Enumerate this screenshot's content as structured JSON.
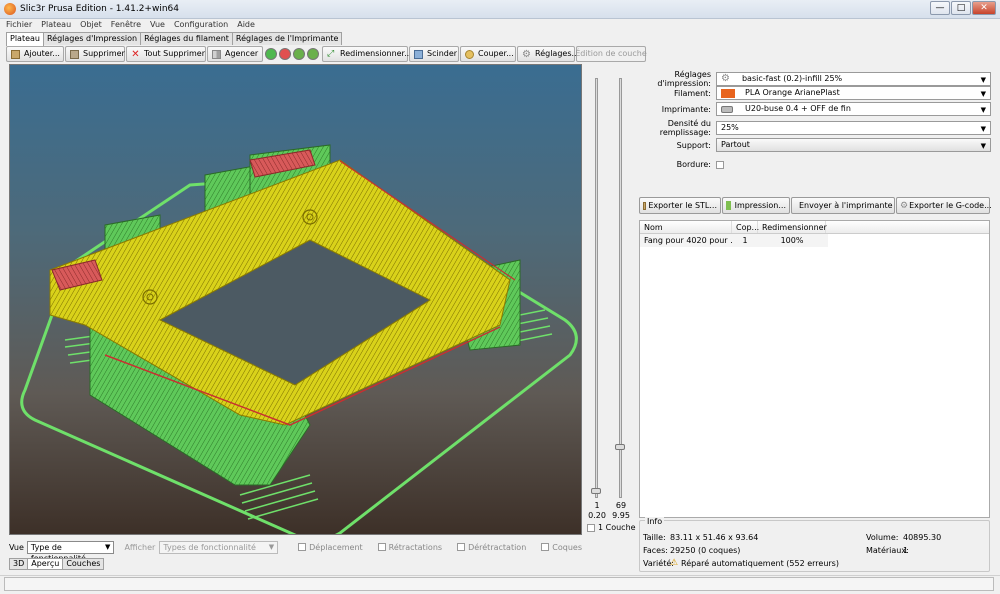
{
  "window": {
    "title": "Slic3r Prusa Edition - 1.41.2+win64",
    "minimize": "—",
    "maximize": "□",
    "close": "✕"
  },
  "menu": [
    "Fichier",
    "Plateau",
    "Objet",
    "Fenêtre",
    "Vue",
    "Configuration",
    "Aide"
  ],
  "tabs": [
    "Plateau",
    "Réglages d'Impression",
    "Réglages du filament",
    "Réglages de l'Imprimante"
  ],
  "toolbar": {
    "add": "Ajouter...",
    "delete": "Supprimer",
    "delete_all": "Tout Supprimer",
    "arrange": "Agencer",
    "scale": "Redimensionner...",
    "split": "Scinder",
    "cut": "Couper...",
    "settings": "Réglages...",
    "layer_edit": "Édition de couche"
  },
  "slider": {
    "top_layer": "69",
    "top_height": "9.95",
    "bottom_layer": "1",
    "bottom_height": "0.20",
    "one_layer_label": "1 Couche"
  },
  "view_controls": {
    "vue_label": "Vue",
    "vue_value": "Type de fonctionnalité",
    "afficher_label": "Afficher",
    "afficher_value": "Types de fonctionnalité",
    "checks": [
      "Déplacement",
      "Rétractations",
      "Dérétractation",
      "Coques"
    ]
  },
  "view_tabs": [
    "3D",
    "Aperçu",
    "Couches"
  ],
  "settings": {
    "print_label": "Réglages d'impression:",
    "print_value": "basic-fast (0.2)-infill 25%",
    "filament_label": "Filament:",
    "filament_value": "PLA Orange ArianePlast",
    "filament_color": "#e8641e",
    "printer_label": "Imprimante:",
    "printer_value": "U20-buse 0.4 + OFF de fin",
    "infill_label_1": "Densité du",
    "infill_label_2": "remplissage:",
    "infill_value": "25%",
    "support_label": "Support:",
    "support_value": "Partout",
    "brim_label": "Bordure:"
  },
  "actions": {
    "export_stl": "Exporter le STL...",
    "print": "Impression...",
    "send": "Envoyer à l'imprimante",
    "export_gcode": "Exporter le G-code..."
  },
  "object_list": {
    "headers": [
      "Nom",
      "Cop...",
      "Redimensionner"
    ],
    "rows": [
      {
        "name": "Fang pour 4020 pour ...",
        "copies": "1",
        "scale": "100%"
      }
    ]
  },
  "info": {
    "title": "Info",
    "size_label": "Taille:",
    "size_value": "83.11 x 51.46 x 93.64",
    "volume_label": "Volume:",
    "volume_value": "40895.30",
    "facets_label": "Faces:",
    "facets_value": "29250 (0 coques)",
    "materials_label": "Matériaux:",
    "materials_value": "1",
    "manifold_label": "Variété:",
    "manifold_value": "Réparé automatiquement (552 erreurs)"
  }
}
